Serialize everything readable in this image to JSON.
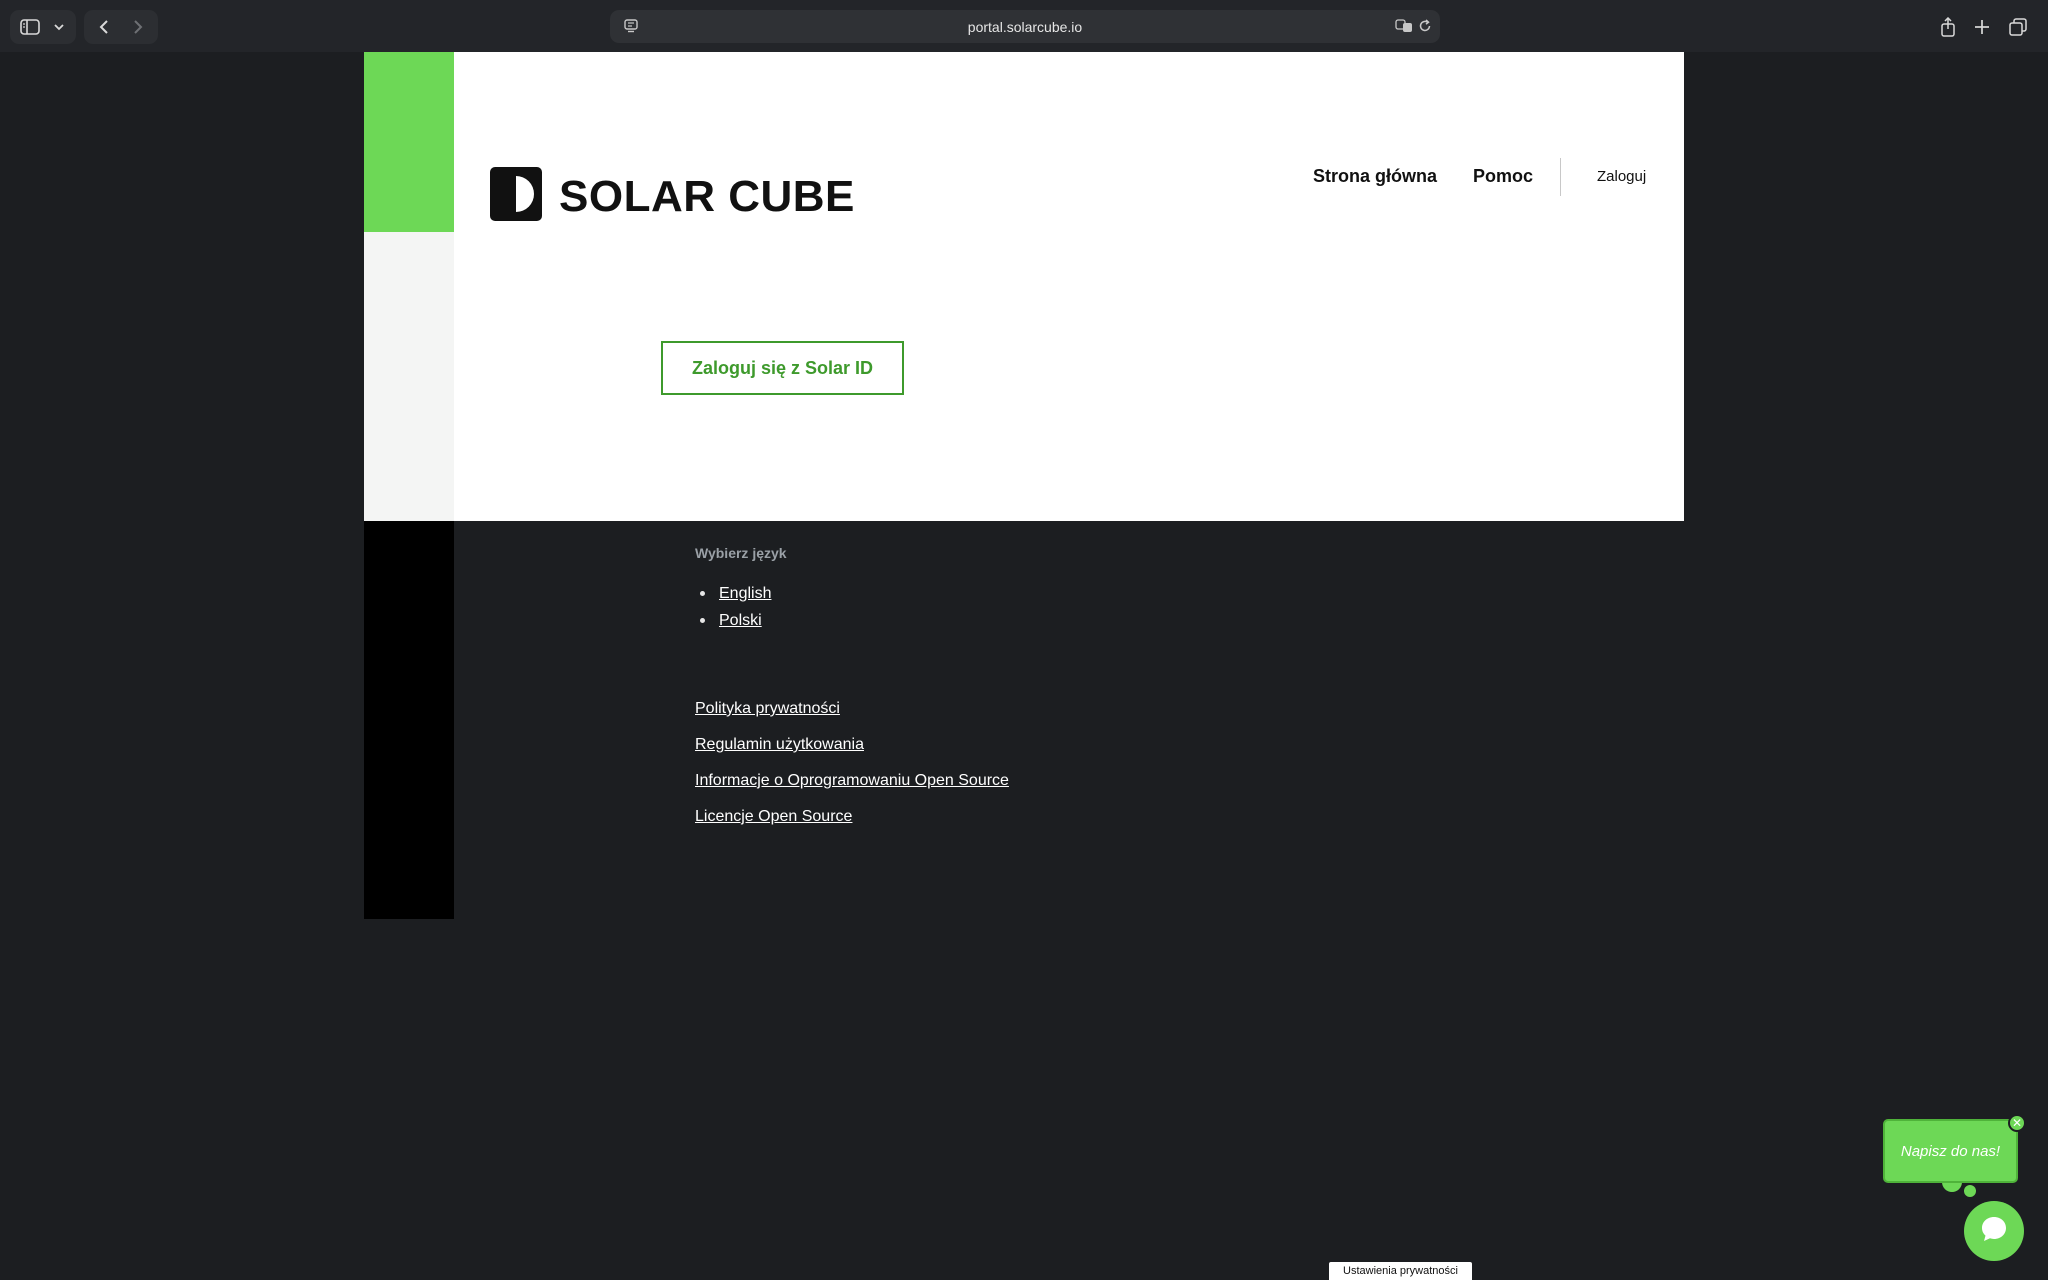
{
  "browser": {
    "url": "portal.solarcube.io",
    "icons": [
      "sidebar-icon",
      "chevron-down-icon",
      "back-icon",
      "forward-icon",
      "site-settings-icon",
      "translate-icon",
      "reload-icon",
      "share-icon",
      "new-tab-icon",
      "tabs-overview-icon"
    ]
  },
  "header": {
    "logo_text": "SOLAR CUBE",
    "nav": {
      "home": "Strona główna",
      "help": "Pomoc",
      "login": "Zaloguj"
    }
  },
  "main": {
    "login_button": "Zaloguj się z Solar ID"
  },
  "footer": {
    "language_title": "Wybierz język",
    "languages": [
      "English",
      "Polski"
    ],
    "links": [
      "Polityka prywatności",
      "Regulamin użytkowania",
      "Informacje o Oprogramowaniu Open Source",
      "Licencje Open Source"
    ]
  },
  "chat": {
    "bubble_text": "Napisz do nas!"
  },
  "privacy_settings": "Ustawienia prywatności",
  "colors": {
    "brand_green": "#6dd856",
    "button_green": "#3e9a2c",
    "background": "#1c1e21"
  }
}
